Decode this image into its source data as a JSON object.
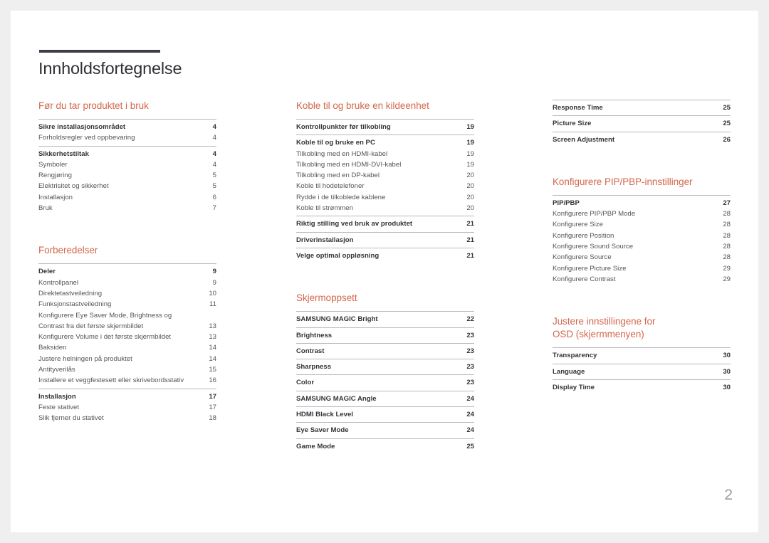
{
  "document": {
    "title": "Innholdsfortegnelse",
    "folio": "2",
    "accent_color": "#d2674b",
    "rule_color": "#3e3e48"
  },
  "columns": [
    {
      "name": "column-1",
      "sections": [
        {
          "title": "Før du tar produktet i bruk",
          "groups": [
            {
              "entries": [
                {
                  "label": "Sikre installasjonsområdet",
                  "page": "4",
                  "level": 0
                },
                {
                  "label": "Forholdsregler ved oppbevaring",
                  "page": "4",
                  "level": 1
                }
              ]
            },
            {
              "entries": [
                {
                  "label": "Sikkerhetstiltak",
                  "page": "4",
                  "level": 0
                },
                {
                  "label": "Symboler",
                  "page": "4",
                  "level": 1
                },
                {
                  "label": "Rengjøring",
                  "page": "5",
                  "level": 1
                },
                {
                  "label": "Elektrisitet og sikkerhet",
                  "page": "5",
                  "level": 1
                },
                {
                  "label": "Installasjon",
                  "page": "6",
                  "level": 1
                },
                {
                  "label": "Bruk",
                  "page": "7",
                  "level": 1
                }
              ]
            }
          ]
        },
        {
          "title": "Forberedelser",
          "spacer": true,
          "groups": [
            {
              "entries": [
                {
                  "label": "Deler",
                  "page": "9",
                  "level": 0
                },
                {
                  "label": "Kontrollpanel",
                  "page": "9",
                  "level": 1
                },
                {
                  "label": "Direktetastveiledning",
                  "page": "10",
                  "level": 1
                },
                {
                  "label": "Funksjonstastveiledning",
                  "page": "11",
                  "level": 1
                },
                {
                  "label": "Konfigurere Eye Saver Mode, Brightness og Contrast fra det første skjermbildet",
                  "line1": "Konfigurere Eye Saver Mode, Brightness og",
                  "line2": "Contrast fra det første skjermbildet",
                  "page": "13",
                  "level": 1,
                  "wrap": true
                },
                {
                  "label": "Konfigurere Volume i det første skjermbildet",
                  "page": "13",
                  "level": 1
                },
                {
                  "label": "Baksiden",
                  "page": "14",
                  "level": 1
                },
                {
                  "label": "Justere helningen på produktet",
                  "page": "14",
                  "level": 1
                },
                {
                  "label": "Antityverilås",
                  "page": "15",
                  "level": 1
                },
                {
                  "label": "Installere et veggfestesett eller skrivebordsstativ",
                  "page": "16",
                  "level": 1
                }
              ]
            },
            {
              "entries": [
                {
                  "label": "Installasjon",
                  "page": "17",
                  "level": 0
                },
                {
                  "label": "Feste stativet",
                  "page": "17",
                  "level": 1
                },
                {
                  "label": "Slik fjerner du stativet",
                  "page": "18",
                  "level": 1
                }
              ]
            }
          ]
        }
      ]
    },
    {
      "name": "column-2",
      "sections": [
        {
          "title": "Koble til og bruke en kildeenhet",
          "groups": [
            {
              "entries": [
                {
                  "label": "Kontrollpunkter før tilkobling",
                  "page": "19",
                  "level": 0
                }
              ]
            },
            {
              "entries": [
                {
                  "label": "Koble til og bruke en PC",
                  "page": "19",
                  "level": 0
                },
                {
                  "label": "Tilkobling med en HDMI-kabel",
                  "page": "19",
                  "level": 1
                },
                {
                  "label": "Tilkobling med en HDMI-DVI-kabel",
                  "page": "19",
                  "level": 1
                },
                {
                  "label": "Tilkobling med en DP-kabel",
                  "page": "20",
                  "level": 1
                },
                {
                  "label": "Koble til hodetelefoner",
                  "page": "20",
                  "level": 1
                },
                {
                  "label": "Rydde i de tilkoblede kablene",
                  "page": "20",
                  "level": 1
                },
                {
                  "label": "Koble til strømmen",
                  "page": "20",
                  "level": 1
                }
              ]
            },
            {
              "entries": [
                {
                  "label": "Riktig stilling ved bruk av produktet",
                  "page": "21",
                  "level": 0
                }
              ]
            },
            {
              "entries": [
                {
                  "label": "Driverinstallasjon",
                  "page": "21",
                  "level": 0
                }
              ]
            },
            {
              "entries": [
                {
                  "label": "Velge optimal oppløsning",
                  "page": "21",
                  "level": 0
                }
              ]
            }
          ]
        },
        {
          "title": "Skjermoppsett",
          "spacer": true,
          "groups": [
            {
              "entries": [
                {
                  "label": "SAMSUNG MAGIC Bright",
                  "page": "22",
                  "level": 0
                }
              ]
            },
            {
              "entries": [
                {
                  "label": "Brightness",
                  "page": "23",
                  "level": 0
                }
              ]
            },
            {
              "entries": [
                {
                  "label": "Contrast",
                  "page": "23",
                  "level": 0
                }
              ]
            },
            {
              "entries": [
                {
                  "label": "Sharpness",
                  "page": "23",
                  "level": 0
                }
              ]
            },
            {
              "entries": [
                {
                  "label": "Color",
                  "page": "23",
                  "level": 0
                }
              ]
            },
            {
              "entries": [
                {
                  "label": "SAMSUNG MAGIC Angle",
                  "page": "24",
                  "level": 0
                }
              ]
            },
            {
              "entries": [
                {
                  "label": "HDMI Black Level",
                  "page": "24",
                  "level": 0
                }
              ]
            },
            {
              "entries": [
                {
                  "label": "Eye Saver Mode",
                  "page": "24",
                  "level": 0
                }
              ]
            },
            {
              "entries": [
                {
                  "label": "Game Mode",
                  "page": "25",
                  "level": 0
                }
              ]
            }
          ]
        }
      ]
    },
    {
      "name": "column-3",
      "sections": [
        {
          "title": "",
          "groups": [
            {
              "entries": [
                {
                  "label": "Response Time",
                  "page": "25",
                  "level": 0
                }
              ]
            },
            {
              "entries": [
                {
                  "label": "Picture Size",
                  "page": "25",
                  "level": 0
                }
              ]
            },
            {
              "entries": [
                {
                  "label": "Screen Adjustment",
                  "page": "26",
                  "level": 0
                }
              ]
            }
          ]
        },
        {
          "title": "Konfigurere PIP/PBP-innstillinger",
          "spacer": true,
          "groups": [
            {
              "entries": [
                {
                  "label": "PIP/PBP",
                  "page": "27",
                  "level": 0
                },
                {
                  "label": "Konfigurere PIP/PBP Mode",
                  "page": "28",
                  "level": 1
                },
                {
                  "label": "Konfigurere Size",
                  "page": "28",
                  "level": 1
                },
                {
                  "label": "Konfigurere Position",
                  "page": "28",
                  "level": 1
                },
                {
                  "label": "Konfigurere Sound Source",
                  "page": "28",
                  "level": 1
                },
                {
                  "label": "Konfigurere Source",
                  "page": "28",
                  "level": 1
                },
                {
                  "label": "Konfigurere Picture Size",
                  "page": "29",
                  "level": 1
                },
                {
                  "label": "Konfigurere Contrast",
                  "page": "29",
                  "level": 1
                }
              ]
            }
          ]
        },
        {
          "title": "Justere innstillingene for\nOSD (skjermmenyen)",
          "spacer": true,
          "groups": [
            {
              "entries": [
                {
                  "label": "Transparency",
                  "page": "30",
                  "level": 0
                }
              ]
            },
            {
              "entries": [
                {
                  "label": "Language",
                  "page": "30",
                  "level": 0
                }
              ]
            },
            {
              "entries": [
                {
                  "label": "Display Time",
                  "page": "30",
                  "level": 0
                }
              ]
            }
          ]
        }
      ]
    }
  ]
}
